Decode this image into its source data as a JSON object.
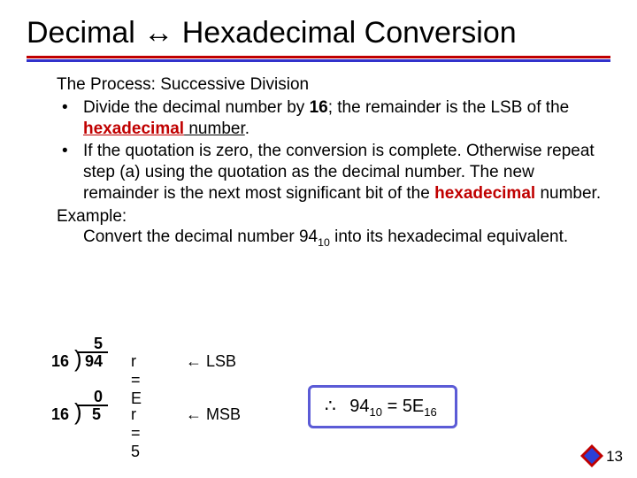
{
  "title": "Decimal ↔ Hexadecimal Conversion",
  "process_heading": "The Process: Successive Division",
  "bullets": [
    {
      "pre": "Divide the decimal number by ",
      "bold1": "16",
      "mid": "; the remainder is the LSB of the ",
      "boldred": "hexadecimal",
      "post_u": " number",
      "tail": "."
    },
    {
      "full_pre": "If the quotation is zero, the conversion is complete. Otherwise repeat step (a) using the quotation as the decimal number. The new remainder is the next most significant bit of the ",
      "boldred": "hexadecimal",
      "tail2": " number."
    }
  ],
  "example_label": "Example:",
  "example_line_pre": "Convert the decimal number 94",
  "example_sub": "10",
  "example_line_post": " into its hexadecimal equivalent.",
  "ld": [
    {
      "divisor": "16",
      "quot": "5",
      "dividend": "94",
      "rem": "r = E",
      "tag": "← LSB"
    },
    {
      "divisor": "16",
      "quot": "0",
      "dividend": "5",
      "rem": "r = 5",
      "tag": "← MSB"
    }
  ],
  "result": {
    "therefore": "∴",
    "lhs_num": "94",
    "lhs_sub": "10",
    "eq": " = ",
    "rhs_num": "5E",
    "rhs_sub": "16"
  },
  "page_number": "13"
}
